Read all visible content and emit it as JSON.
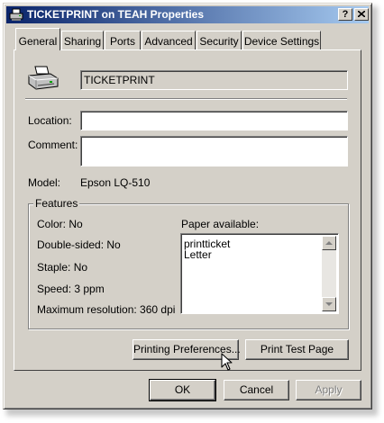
{
  "window": {
    "title": "TICKETPRINT on TEAH Properties",
    "help_button": "?",
    "close_button": "X"
  },
  "tabs": [
    {
      "label": "General",
      "active": true
    },
    {
      "label": "Sharing",
      "active": false
    },
    {
      "label": "Ports",
      "active": false
    },
    {
      "label": "Advanced",
      "active": false
    },
    {
      "label": "Security",
      "active": false
    },
    {
      "label": "Device Settings",
      "active": false
    }
  ],
  "general": {
    "printer_icon": "printer-icon",
    "printer_name": "TICKETPRINT",
    "location_label": "Location:",
    "location_value": "",
    "comment_label": "Comment:",
    "comment_value": "",
    "model_label": "Model:",
    "model_value": "Epson LQ-510"
  },
  "features": {
    "title": "Features",
    "color": "Color: No",
    "double_sided": "Double-sided: No",
    "staple": "Staple: No",
    "speed": "Speed: 3 ppm",
    "max_resolution": "Maximum resolution: 360 dpi",
    "paper_label": "Paper available:",
    "paper_items": [
      "printticket",
      "Letter"
    ]
  },
  "buttons": {
    "printing_preferences": "Printing Preferences...",
    "print_test_page": "Print Test Page",
    "ok": "OK",
    "cancel": "Cancel",
    "apply": "Apply"
  }
}
